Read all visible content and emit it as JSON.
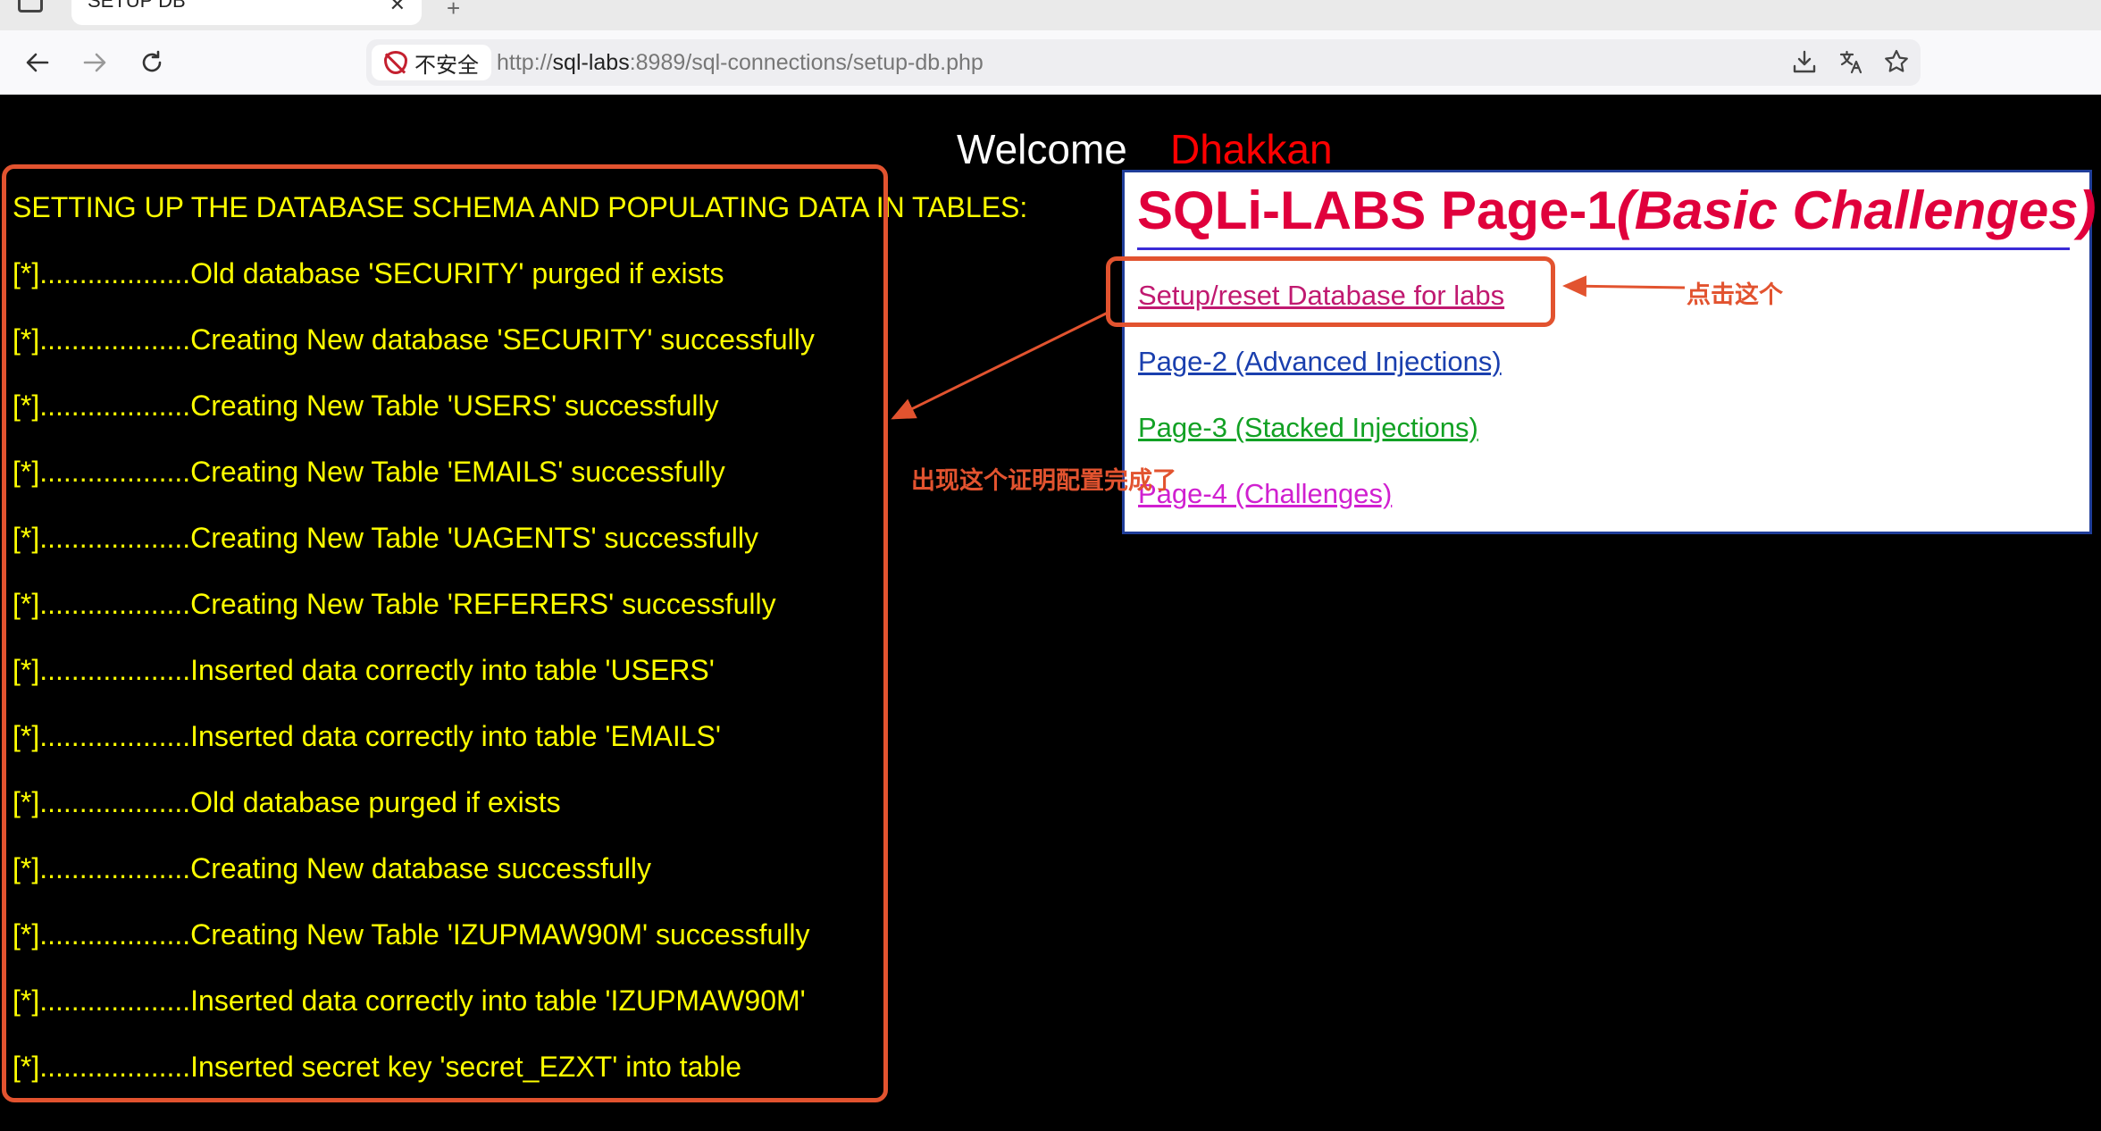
{
  "browser": {
    "tab_title": "SETUP DB",
    "tab_close_glyph": "✕",
    "new_tab_glyph": "+",
    "security_label": "不安全",
    "url_prefix": "http://",
    "url_host": "sql-labs",
    "url_rest": ":8989/sql-connections/setup-db.php",
    "icons": [
      "back-icon",
      "forward-icon",
      "reload-icon",
      "insecure-icon",
      "download-icon",
      "translate-icon",
      "bookmark-star-icon"
    ]
  },
  "welcome": {
    "label": "Welcome",
    "name": "Dhakkan"
  },
  "setup": {
    "heading": "SETTING UP THE DATABASE SCHEMA AND POPULATING DATA IN TABLES:",
    "lines": [
      "[*]...................Old database 'SECURITY' purged if exists",
      "[*]...................Creating New database 'SECURITY' successfully",
      "[*]...................Creating New Table 'USERS' successfully",
      "[*]...................Creating New Table 'EMAILS' successfully",
      "[*]...................Creating New Table 'UAGENTS' successfully",
      "[*]...................Creating New Table 'REFERERS' successfully",
      "[*]...................Inserted data correctly into table 'USERS'",
      "[*]...................Inserted data correctly into table 'EMAILS'",
      "[*]...................Old database purged if exists",
      "[*]...................Creating New database successfully",
      "[*]...................Creating New Table 'IZUPMAW90M' successfully",
      "[*]...................Inserted data correctly into table 'IZUPMAW90M'",
      "[*]...................Inserted secret key 'secret_EZXT' into table"
    ]
  },
  "menu": {
    "title_main": "SQLi-LABS Page-1",
    "title_sub": "(Basic Challenges)",
    "links": [
      "Setup/reset Database for labs",
      "Page-2 (Advanced Injections)",
      "Page-3 (Stacked Injections)",
      "Page-4 (Challenges)"
    ],
    "colors": {
      "title": "#e0003c",
      "link_1": "#c01970",
      "link_2": "#1a3fae",
      "link_3": "#12a124",
      "link_4": "#d020d0"
    }
  },
  "annotations": {
    "click_here": "点击这个",
    "config_done": "出现这个证明配置完成了",
    "color": "#e2532f"
  }
}
